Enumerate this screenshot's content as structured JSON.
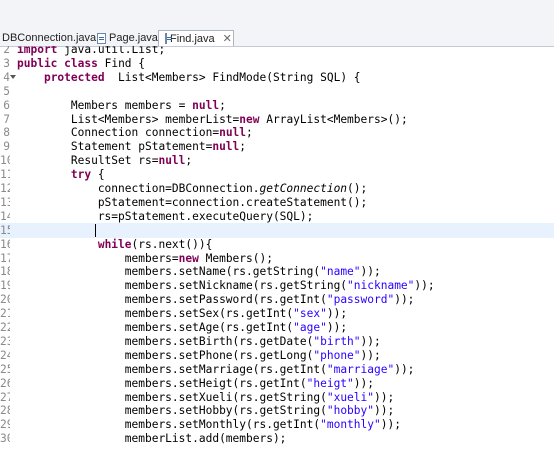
{
  "tabs": [
    {
      "label": "DBConnection.java",
      "active": false
    },
    {
      "label": "Page.java",
      "active": false
    },
    {
      "label": "Find.java",
      "active": true,
      "close": "✕"
    }
  ],
  "code": [
    {
      "num": "2",
      "text": "import java.util.List;"
    },
    {
      "num": "3",
      "text": "public class Find {"
    },
    {
      "num": "4",
      "text": "    protected  List<Members> FindMode(String SQL) {"
    },
    {
      "num": "5",
      "text": ""
    },
    {
      "num": "6",
      "text": "        Members members = null;"
    },
    {
      "num": "7",
      "text": "        List<Members> memberList=new ArrayList<Members>();"
    },
    {
      "num": "8",
      "text": "        Connection connection=null;"
    },
    {
      "num": "9",
      "text": "        Statement pStatement=null;"
    },
    {
      "num": "10",
      "text": "        ResultSet rs=null;"
    },
    {
      "num": "11",
      "text": "        try {"
    },
    {
      "num": "12",
      "text": "            connection=DBConnection.getConnection();"
    },
    {
      "num": "13",
      "text": "            pStatement=connection.createStatement();"
    },
    {
      "num": "14",
      "text": "            rs=pStatement.executeQuery(SQL);"
    },
    {
      "num": "15",
      "text": ""
    },
    {
      "num": "16",
      "text": "            while(rs.next()){"
    },
    {
      "num": "17",
      "text": "                members=new Members();"
    },
    {
      "num": "18",
      "text": "                members.setName(rs.getString(\"name\"));"
    },
    {
      "num": "19",
      "text": "                members.setNickname(rs.getString(\"nickname\"));"
    },
    {
      "num": "20",
      "text": "                members.setPassword(rs.getInt(\"password\"));"
    },
    {
      "num": "21",
      "text": "                members.setSex(rs.getInt(\"sex\"));"
    },
    {
      "num": "22",
      "text": "                members.setAge(rs.getInt(\"age\"));"
    },
    {
      "num": "23",
      "text": "                members.setBirth(rs.getDate(\"birth\"));"
    },
    {
      "num": "24",
      "text": "                members.setPhone(rs.getLong(\"phone\"));"
    },
    {
      "num": "25",
      "text": "                members.setMarriage(rs.getInt(\"marriage\"));"
    },
    {
      "num": "26",
      "text": "                members.setHeigt(rs.getInt(\"heigt\"));"
    },
    {
      "num": "27",
      "text": "                members.setXueli(rs.getString(\"xueli\"));"
    },
    {
      "num": "28",
      "text": "                members.setHobby(rs.getString(\"hobby\"));"
    },
    {
      "num": "29",
      "text": "                members.setMonthly(rs.getInt(\"monthly\"));"
    },
    {
      "num": "30",
      "text": "                memberList.add(members);"
    }
  ]
}
